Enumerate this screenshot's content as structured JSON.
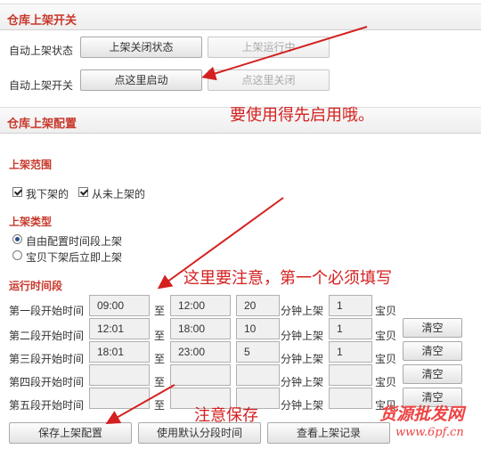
{
  "section1": {
    "title": "仓库上架开关",
    "status_label": "自动上架状态",
    "status_btn_off": "上架关闭状态",
    "status_btn_running": "上架运行中",
    "switch_label": "自动上架开关",
    "btn_start": "点这里启动",
    "btn_stop": "点这里关闭"
  },
  "section2": {
    "title": "仓库上架配置",
    "scope": {
      "title": "上架范围",
      "opt1": "我下架的",
      "opt2": "从未上架的"
    },
    "type": {
      "title": "上架类型",
      "opt1": "自由配置时间段上架",
      "opt2": "宝贝下架后立即上架"
    },
    "period": {
      "title": "运行时间段",
      "to": "至",
      "minutes_unit": "分钟上架",
      "item_unit": "宝贝",
      "clear_label": "清空",
      "rows": [
        {
          "label": "第一段开始时间",
          "start": "09:00",
          "end": "12:00",
          "minutes": "20",
          "count": "1"
        },
        {
          "label": "第二段开始时间",
          "start": "12:01",
          "end": "18:00",
          "minutes": "10",
          "count": "1"
        },
        {
          "label": "第三段开始时间",
          "start": "18:01",
          "end": "23:00",
          "minutes": "5",
          "count": "1"
        },
        {
          "label": "第四段开始时间",
          "start": "",
          "end": "",
          "minutes": "",
          "count": ""
        },
        {
          "label": "第五段开始时间",
          "start": "",
          "end": "",
          "minutes": "",
          "count": ""
        }
      ]
    },
    "buttons": {
      "save": "保存上架配置",
      "default": "使用默认分段时间",
      "records": "查看上架记录"
    }
  },
  "annotations": {
    "enable_first": "要使用得先启用哦。",
    "first_required": "这里要注意，第一个必须填写",
    "save_note": "注意保存"
  },
  "watermark": {
    "brand": "货源批发网",
    "url": "www.6pf.cn"
  },
  "colors": {
    "accent_red": "#c8382b",
    "annotation_red": "#d42020"
  }
}
